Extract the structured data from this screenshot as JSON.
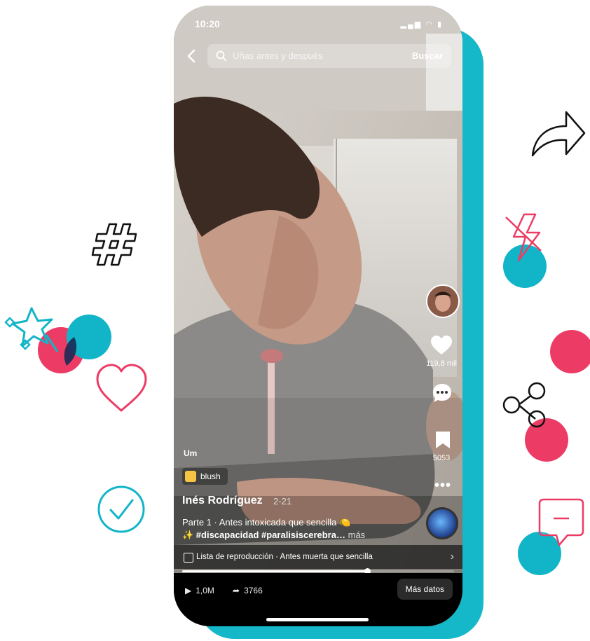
{
  "status": {
    "time": "10:20"
  },
  "search": {
    "query": "Uñas antes y después",
    "submit_label": "Buscar"
  },
  "side_actions": {
    "likes": "119,8 mil",
    "saves": "5053",
    "more": "•••"
  },
  "post": {
    "sound_label": "Um",
    "effect_label": "blush",
    "author": "Inés Rodríguez",
    "date": "2-21",
    "caption_line1": "Parte 1 · Antes intoxicada que sencilla 🍋",
    "caption_line2": "✨ #discapacidad #paralisiscerebra…",
    "caption_more": "más"
  },
  "playlist": {
    "label": "Lista de reproducción · Antes muerta que sencilla",
    "progress_fraction": 0.68
  },
  "stats": {
    "views": "1,0M",
    "shares": "3766"
  },
  "bottom": {
    "more_data_label": "Más datos"
  },
  "colors": {
    "teal": "#12b5c8",
    "pink": "#ec3c66",
    "ink": "#111111"
  }
}
